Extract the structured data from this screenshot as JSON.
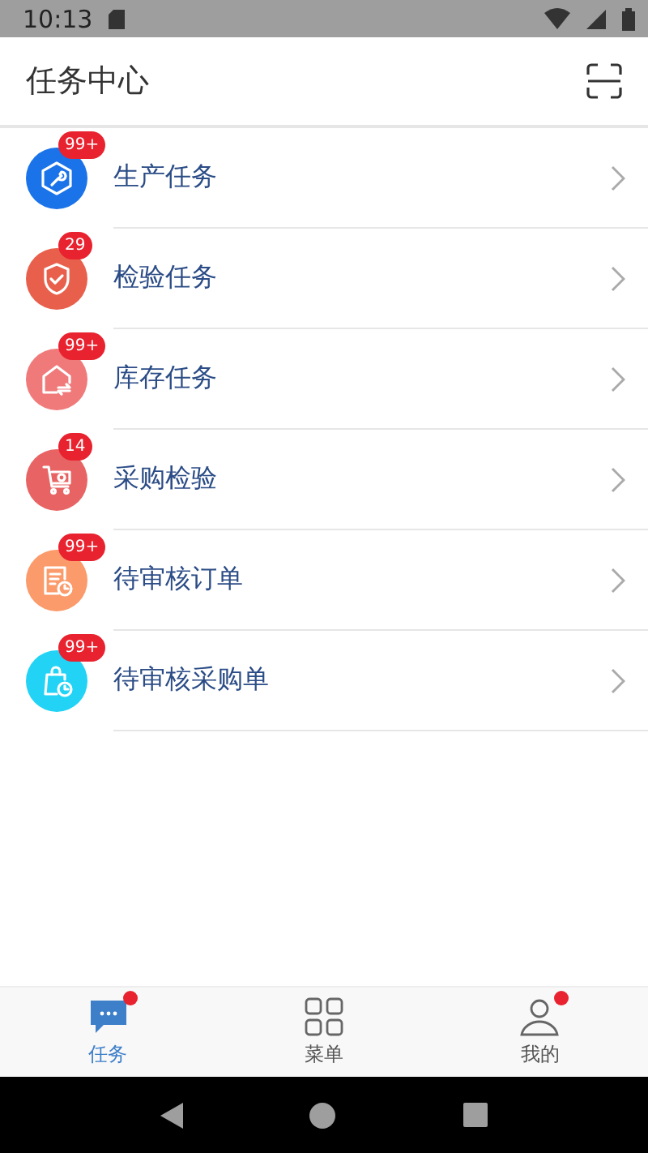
{
  "status_bar": {
    "time": "10:13"
  },
  "header": {
    "title": "任务中心"
  },
  "tasks": [
    {
      "kind": "wrench",
      "label": "生产任务",
      "badge": "99+",
      "color": "#1a73e8"
    },
    {
      "kind": "shield",
      "label": "检验任务",
      "badge": "29",
      "color": "#e8604c"
    },
    {
      "kind": "house",
      "label": "库存任务",
      "badge": "99+",
      "color": "#f07a7a"
    },
    {
      "kind": "cart",
      "label": "采购检验",
      "badge": "14",
      "color": "#e86464"
    },
    {
      "kind": "doc",
      "label": "待审核订单",
      "badge": "99+",
      "color": "#fb9a6a"
    },
    {
      "kind": "bag",
      "label": "待审核采购单",
      "badge": "99+",
      "color": "#22d3f5"
    }
  ],
  "bottom_nav": [
    {
      "kind": "chat",
      "label": "任务",
      "selected": true,
      "dot": true
    },
    {
      "kind": "grid",
      "label": "菜单",
      "selected": false,
      "dot": false
    },
    {
      "kind": "user",
      "label": "我的",
      "selected": false,
      "dot": true
    }
  ]
}
